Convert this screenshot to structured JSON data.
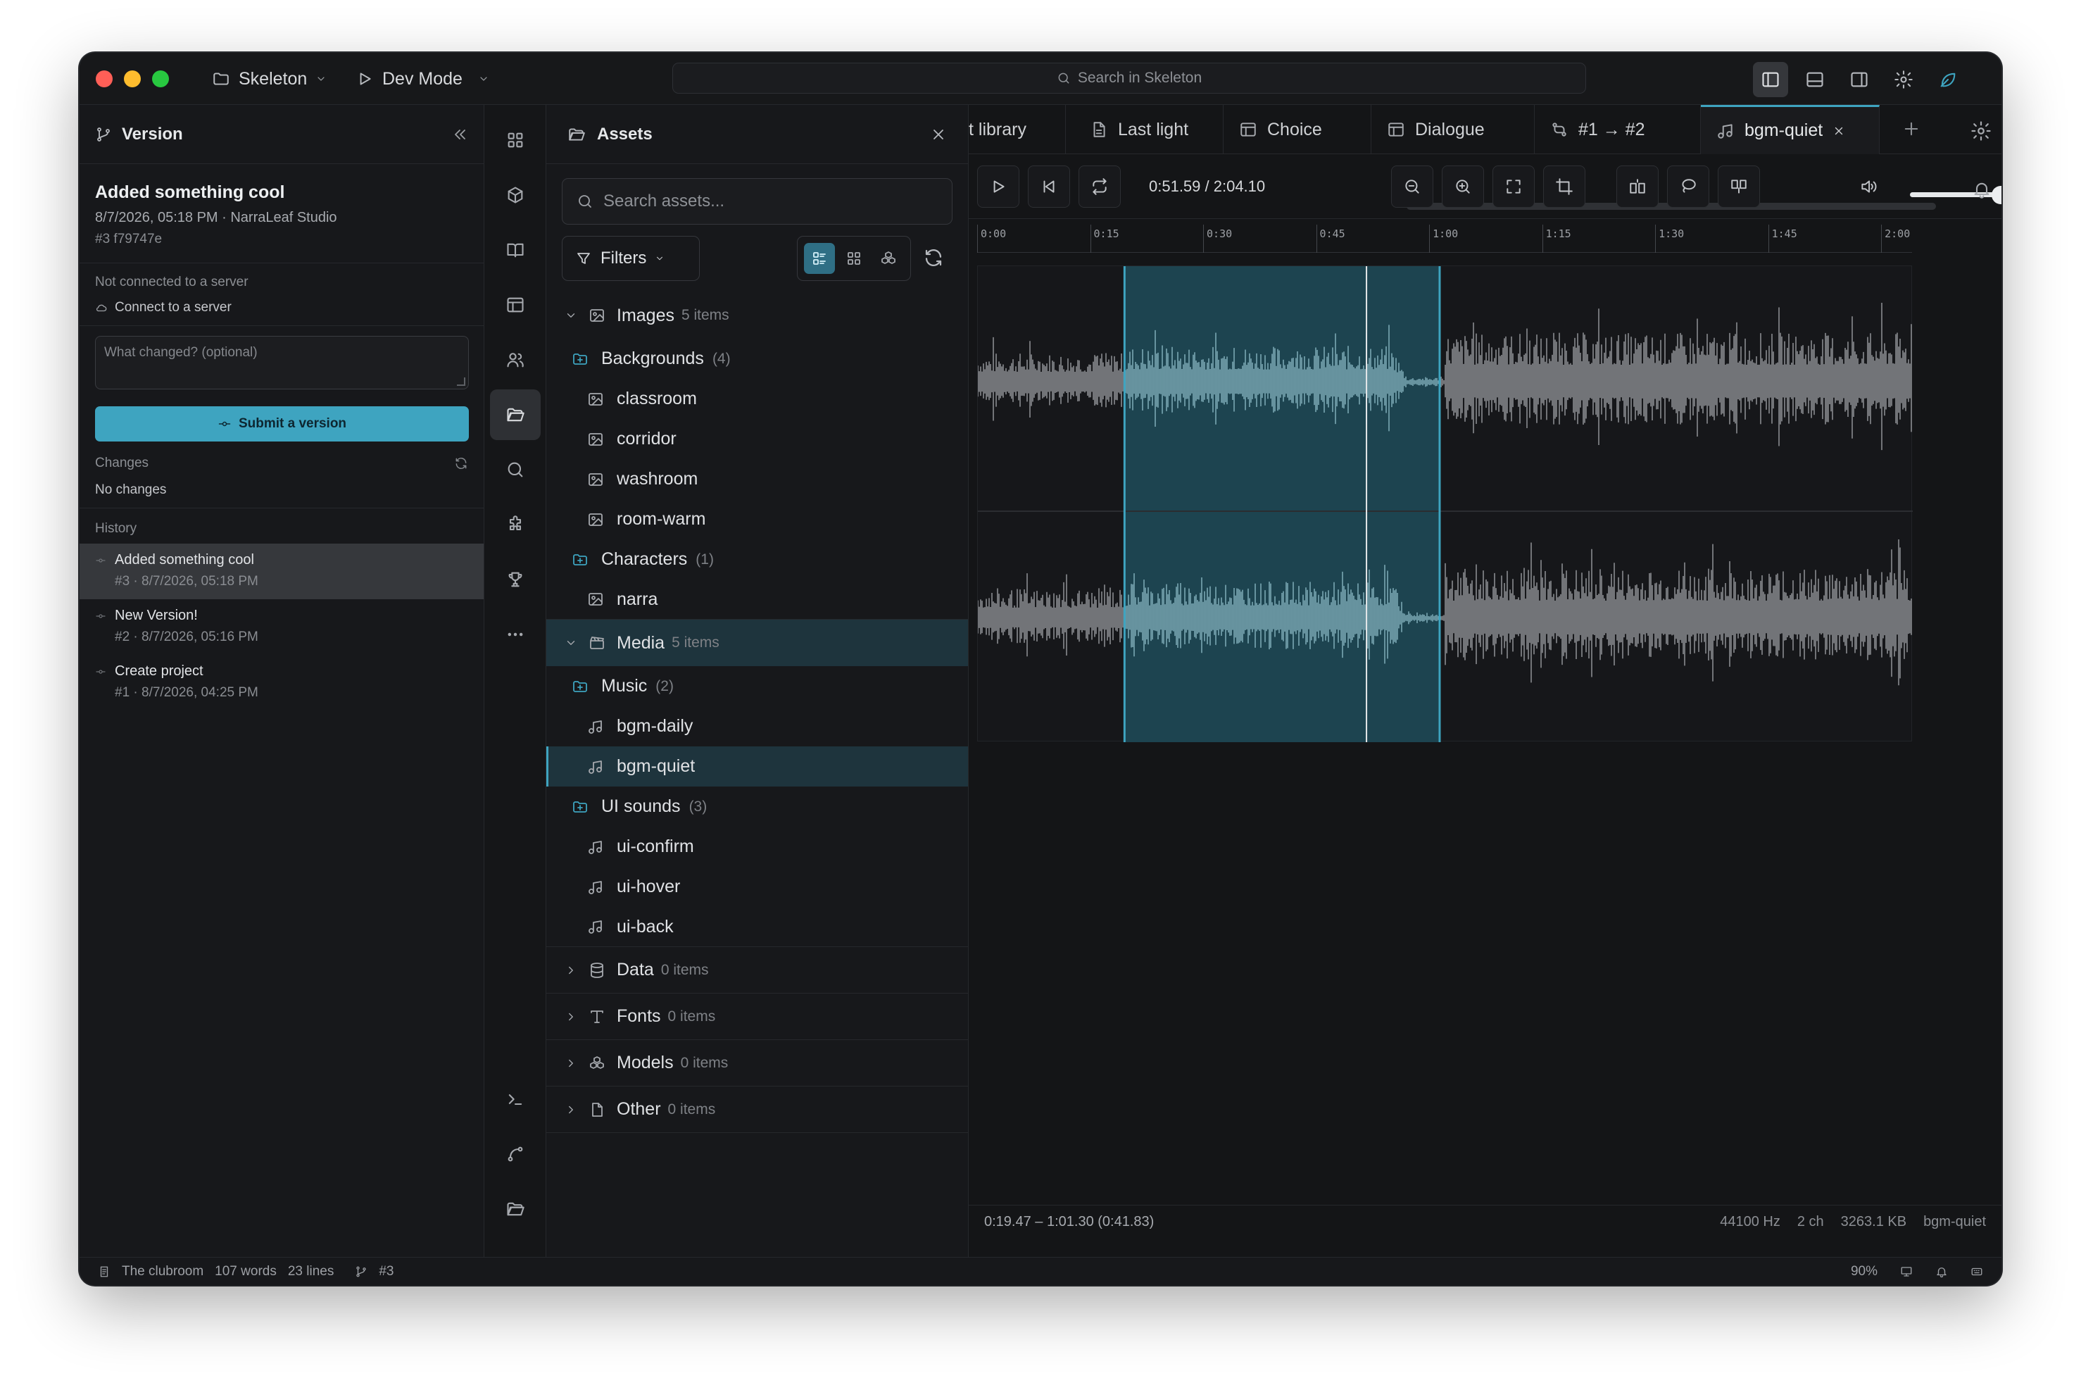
{
  "window": {
    "project": "Skeleton",
    "mode": "Dev Mode",
    "search_placeholder": "Search in Skeleton"
  },
  "version_panel": {
    "title": "Version",
    "latest": {
      "title": "Added something cool",
      "meta": "8/7/2026, 05:18 PM · NarraLeaf Studio",
      "hash": "#3  f79747e"
    },
    "server_status": "Not connected to a server",
    "connect_label": "Connect to a server",
    "textarea_placeholder": "What changed? (optional)",
    "submit_label": "Submit a version",
    "changes_label": "Changes",
    "no_changes": "No changes",
    "history_label": "History",
    "history": [
      {
        "title": "Added something cool",
        "sub": "#3 · 8/7/2026, 05:18 PM"
      },
      {
        "title": "New Version!",
        "sub": "#2 · 8/7/2026, 05:16 PM"
      },
      {
        "title": "Create project",
        "sub": "#1 · 8/7/2026, 04:25 PM"
      }
    ]
  },
  "assets": {
    "title": "Assets",
    "search_placeholder": "Search assets...",
    "filters_label": "Filters",
    "tree": {
      "images": {
        "label": "Images",
        "count": "5 items"
      },
      "backgrounds": {
        "label": "Backgrounds",
        "count": "(4)"
      },
      "bg_files": [
        "classroom",
        "corridor",
        "washroom",
        "room-warm"
      ],
      "characters": {
        "label": "Characters",
        "count": "(1)"
      },
      "char_files": [
        "narra"
      ],
      "media": {
        "label": "Media",
        "count": "5 items"
      },
      "music": {
        "label": "Music",
        "count": "(2)"
      },
      "music_files": [
        "bgm-daily",
        "bgm-quiet"
      ],
      "ui_sounds": {
        "label": "UI sounds",
        "count": "(3)"
      },
      "ui_files": [
        "ui-confirm",
        "ui-hover",
        "ui-back"
      ],
      "data": {
        "label": "Data",
        "count": "0 items"
      },
      "fonts": {
        "label": "Fonts",
        "count": "0 items"
      },
      "models": {
        "label": "Models",
        "count": "0 items"
      },
      "other": {
        "label": "Other",
        "count": "0 items"
      }
    }
  },
  "tabs": [
    {
      "label": "t library"
    },
    {
      "label": "Last light"
    },
    {
      "label": "Choice"
    },
    {
      "label": "Dialogue"
    },
    {
      "label": "#1 → #2"
    },
    {
      "label": "bgm-quiet"
    }
  ],
  "player": {
    "time": "0:51.59 / 2:04.10",
    "volume": 0.95,
    "ruler": [
      "0:00",
      "0:15",
      "0:30",
      "0:45",
      "1:00",
      "1:15",
      "1:30",
      "1:45",
      "2:00"
    ],
    "duration_s": 124.1,
    "selection_start_s": 19.47,
    "selection_end_s": 61.3,
    "playhead_s": 51.59,
    "selection_text": "0:19.47 – 1:01.30 (0:41.83)",
    "sample_rate": "44100 Hz",
    "channels": "2 ch",
    "size": "3263.1 KB",
    "file": "bgm-quiet",
    "colors": {
      "wave": "#8a8c90",
      "wave_selected": "#7aa7b3",
      "selection": "#1d4450",
      "edge": "#3ea4c0",
      "playhead": "#e6e8ea"
    }
  },
  "statusbar": {
    "doc": "The clubroom",
    "words": "107 words",
    "lines": "23 lines",
    "branch": "#3",
    "zoom": "90%"
  }
}
